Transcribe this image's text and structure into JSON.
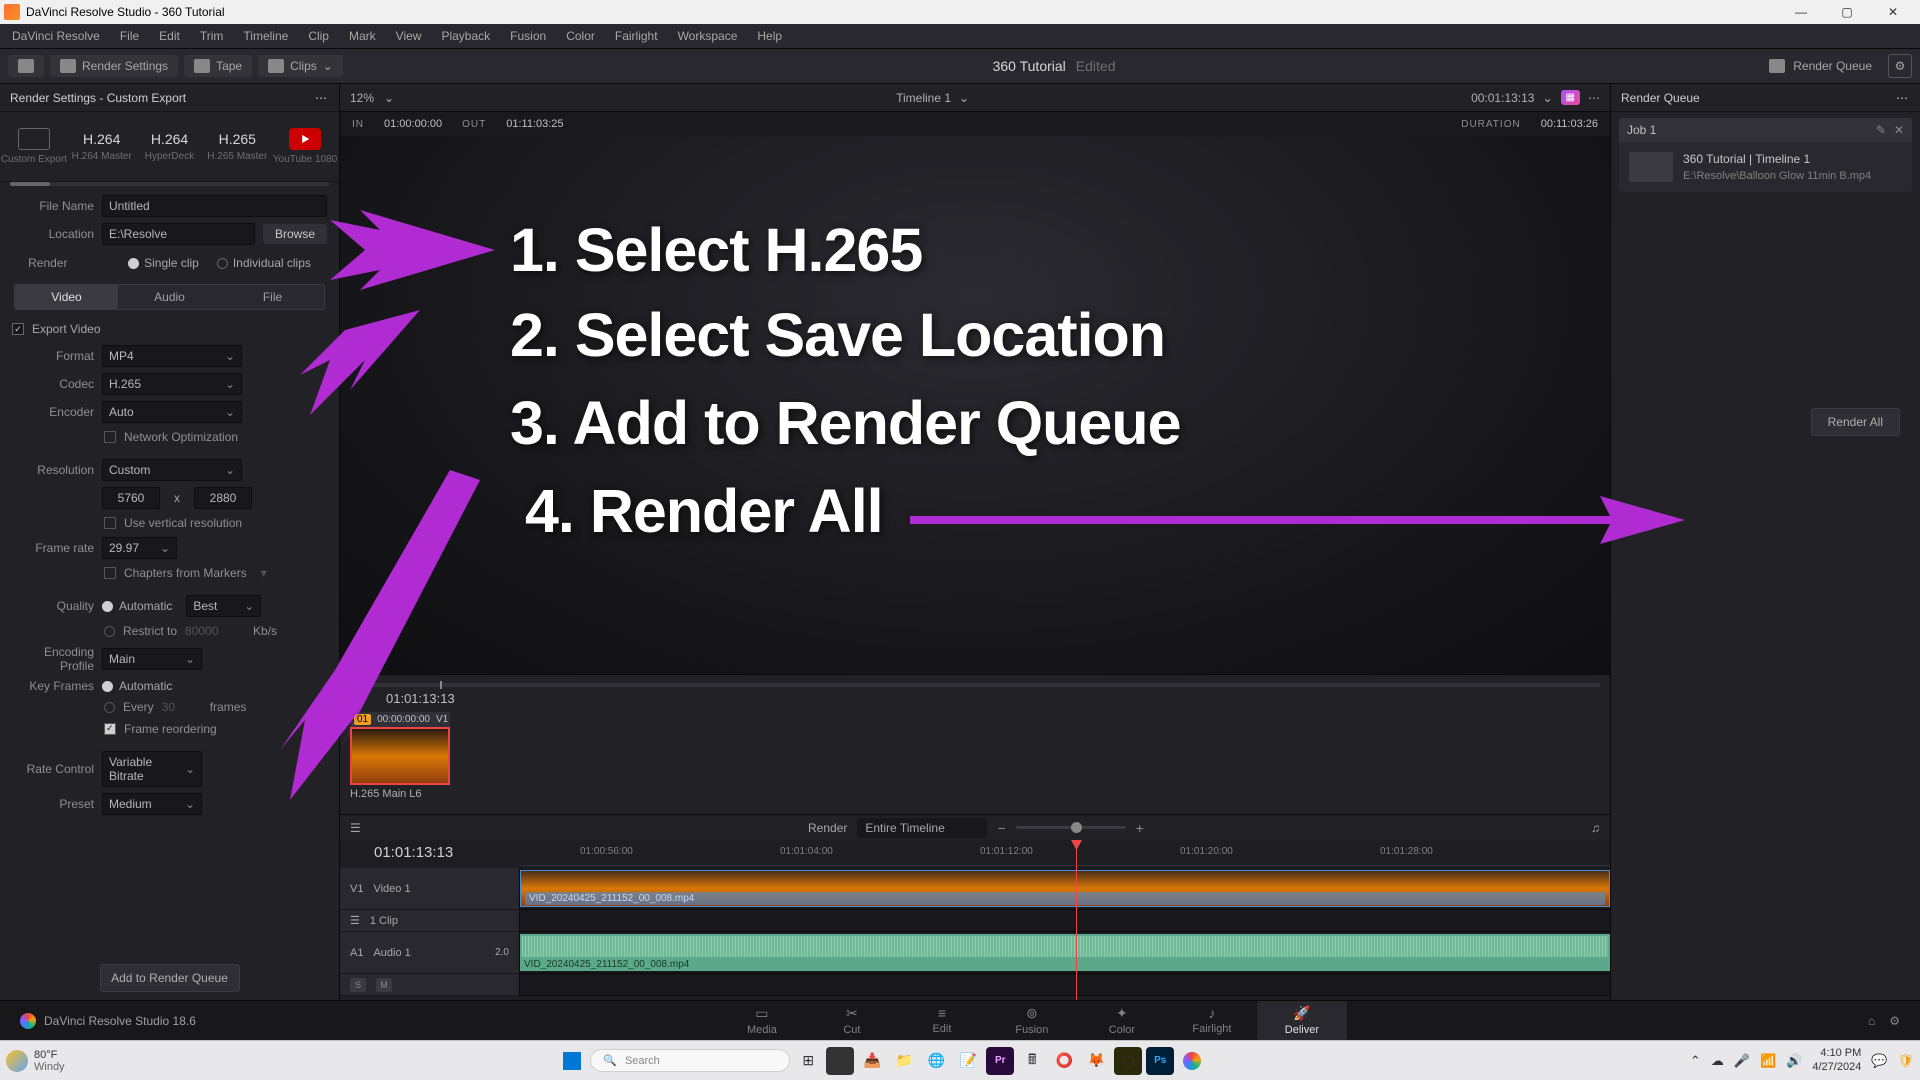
{
  "app": {
    "title": "DaVinci Resolve Studio - 360 Tutorial",
    "version_label": "DaVinci Resolve Studio 18.6"
  },
  "menu": [
    "DaVinci Resolve",
    "File",
    "Edit",
    "Trim",
    "Timeline",
    "Clip",
    "Mark",
    "View",
    "Playback",
    "Fusion",
    "Color",
    "Fairlight",
    "Workspace",
    "Help"
  ],
  "toolbar": {
    "render_settings": "Render Settings",
    "tape": "Tape",
    "clips": "Clips",
    "project_title": "360 Tutorial",
    "edited": "Edited",
    "render_queue": "Render Queue"
  },
  "render_panel": {
    "header": "Render Settings - Custom Export",
    "presets": [
      {
        "label": "",
        "sub": "Custom Export"
      },
      {
        "label": "H.264",
        "sub": "H.264 Master"
      },
      {
        "label": "H.264",
        "sub": "HyperDeck"
      },
      {
        "label": "H.265",
        "sub": "H.265 Master"
      },
      {
        "label": "",
        "sub": "YouTube 1080"
      }
    ],
    "filename_label": "File Name",
    "filename_value": "Untitled",
    "location_label": "Location",
    "location_value": "E:\\Resolve",
    "browse": "Browse",
    "render_label": "Render",
    "single_clip": "Single clip",
    "individual_clips": "Individual clips",
    "tabs": {
      "video": "Video",
      "audio": "Audio",
      "file": "File"
    },
    "export_video": "Export Video",
    "format_label": "Format",
    "format_value": "MP4",
    "codec_label": "Codec",
    "codec_value": "H.265",
    "encoder_label": "Encoder",
    "encoder_value": "Auto",
    "network_opt": "Network Optimization",
    "resolution_label": "Resolution",
    "resolution_value": "Custom",
    "res_w": "5760",
    "res_x": "x",
    "res_h": "2880",
    "use_vertical": "Use vertical resolution",
    "framerate_label": "Frame rate",
    "framerate_value": "29.97",
    "chapters": "Chapters from Markers",
    "quality_label": "Quality",
    "quality_auto": "Automatic",
    "quality_best": "Best",
    "restrict_to": "Restrict to",
    "restrict_kbrs": "Kb/s",
    "restrict_placeholder": "80000",
    "enc_profile_label": "Encoding Profile",
    "enc_profile_value": "Main",
    "keyframes_label": "Key Frames",
    "keyframes_auto": "Automatic",
    "keyframes_every": "Every",
    "keyframes_frames": "frames",
    "keyframes_n": "30",
    "frame_reorder": "Frame reordering",
    "rate_control_label": "Rate Control",
    "rate_control_value": "Variable Bitrate",
    "preset_label": "Preset",
    "preset_value": "Medium",
    "add_to_queue": "Add to Render Queue"
  },
  "viewer": {
    "zoom": "12%",
    "timeline_name": "Timeline 1",
    "master_tc": "00:01:13:13",
    "in_label": "IN",
    "in_tc": "01:00:00:00",
    "out_label": "OUT",
    "out_tc": "01:11:03:25",
    "duration_label": "DURATION",
    "duration_tc": "00:11:03:26"
  },
  "clip_tray": {
    "current_tc": "01:01:13:13",
    "clip_index": "01",
    "clip_tc": "00:00:00:00",
    "clip_track": "V1",
    "clip_name": "H.265 Main L6"
  },
  "timeline_bar": {
    "render_label": "Render",
    "range": "Entire Timeline"
  },
  "timeline": {
    "playhead_tc": "01:01:13:13",
    "ruler": [
      "01:00:56:00",
      "01:01:04:00",
      "01:01:12:00",
      "01:01:20:00",
      "01:01:28:00"
    ],
    "v1_id": "V1",
    "v1_name": "Video 1",
    "v1_clipcount": "1 Clip",
    "a1_id": "A1",
    "a1_name": "Audio 1",
    "a1_level": "2.0",
    "video_clip_name": "VID_20240425_211152_00_008.mp4",
    "audio_clip_name": "VID_20240425_211152_00_008.mp4"
  },
  "render_queue": {
    "header": "Render Queue",
    "job_label": "Job 1",
    "job_title": "360 Tutorial | Timeline 1",
    "job_path": "E:\\Resolve\\Balloon Glow 11min B.mp4",
    "render_all": "Render All"
  },
  "pages": [
    "Media",
    "Cut",
    "Edit",
    "Fusion",
    "Color",
    "Fairlight",
    "Deliver"
  ],
  "taskbar": {
    "temp": "80°F",
    "cond": "Windy",
    "search_placeholder": "Search",
    "time": "4:10 PM",
    "date": "4/27/2024"
  },
  "tutorial": {
    "line1": "1.  Select H.265",
    "line2": "2. Select Save Location",
    "line3": "3. Add to Render Queue",
    "line4": "4. Render All"
  },
  "colors": {
    "accent_purple": "#b02bd1",
    "brand_red": "#ef4444"
  }
}
